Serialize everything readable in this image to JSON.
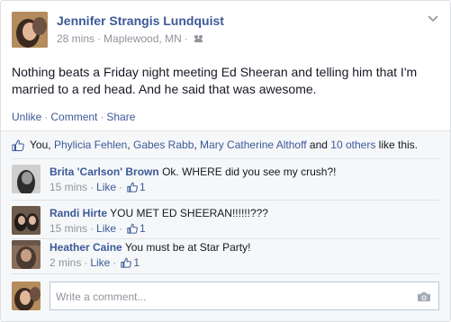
{
  "post": {
    "author": "Jennifer Strangis Lundquist",
    "time": "28 mins",
    "location": "Maplewood, MN",
    "text": "Nothing beats a Friday night meeting Ed Sheeran and telling him that I'm married to a red head. And he said that was awesome.",
    "actions": {
      "unlike": "Unlike",
      "comment": "Comment",
      "share": "Share"
    }
  },
  "likes": {
    "you": "You,",
    "names": [
      "Phylicia Fehlen",
      "Gabes Rabb",
      "Mary Catherine Althoff"
    ],
    "and": "and",
    "others": "10 others",
    "suffix": "like this."
  },
  "comments": [
    {
      "author": "Brita 'Carlson' Brown",
      "text": "Ok. WHERE did you see my crush?!",
      "time": "15 mins",
      "like_label": "Like",
      "likes": "1"
    },
    {
      "author": "Randi Hirte",
      "text": "YOU MET ED SHEERAN!!!!!!???",
      "time": "15 mins",
      "like_label": "Like",
      "likes": "1"
    },
    {
      "author": "Heather Caine",
      "text": "You must be at Star Party!",
      "time": "2 mins",
      "like_label": "Like",
      "likes": "1"
    }
  ],
  "composer": {
    "placeholder": "Write a comment..."
  },
  "colors": {
    "link": "#3b5998",
    "meta": "#90949c",
    "ufi_bg": "#f6f7f9"
  }
}
